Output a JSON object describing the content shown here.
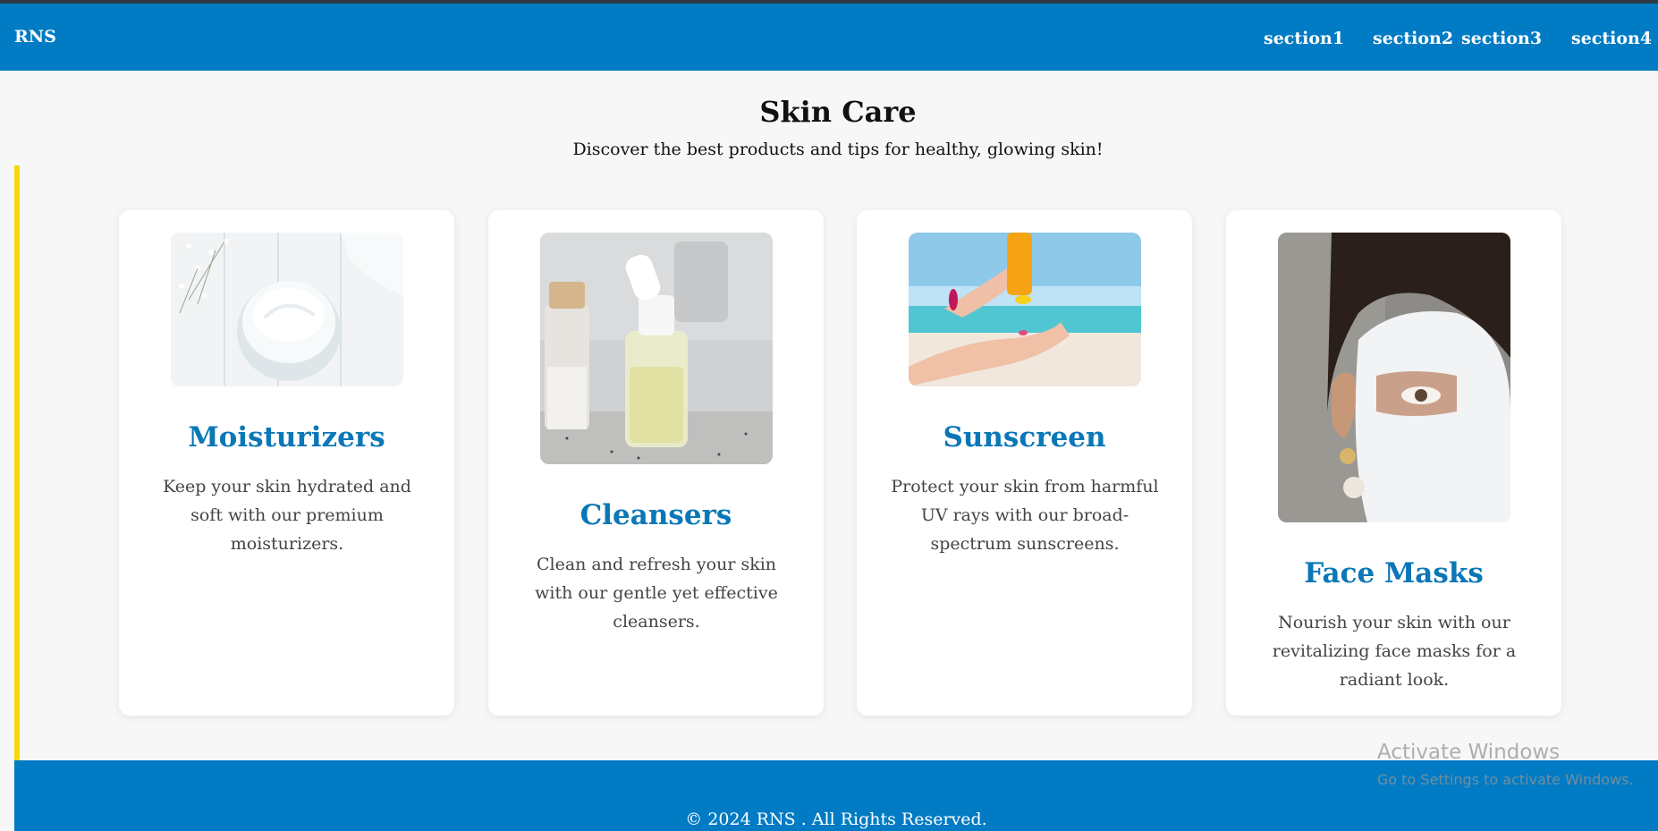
{
  "navbar": {
    "brand": "RNS",
    "links": [
      "section1",
      "section2",
      "section3",
      "section4"
    ]
  },
  "hero": {
    "title": "Skin Care",
    "subtitle": "Discover the best products and tips for healthy, glowing skin!"
  },
  "cards": [
    {
      "title": "Moisturizers",
      "description": "Keep your skin hydrated and soft with our premium moisturizers.",
      "image": "moisturizer-jar-image"
    },
    {
      "title": "Cleansers",
      "description": "Clean and refresh your skin with our gentle yet effective cleansers.",
      "image": "cleanser-bottle-image"
    },
    {
      "title": "Sunscreen",
      "description": "Protect your skin from harmful UV rays with our broad-spectrum sunscreens.",
      "image": "sunscreen-beach-image"
    },
    {
      "title": "Face Masks",
      "description": "Nourish your skin with our revitalizing face masks for a radiant look.",
      "image": "face-mask-image"
    }
  ],
  "footer": {
    "text": "© 2024 RNS . All Rights Reserved."
  },
  "watermark": {
    "title": "Activate Windows",
    "subtitle": "Go to Settings to activate Windows."
  },
  "colors": {
    "primary": "#017bc3",
    "accent": "#f5d90a",
    "card_title": "#0a77b7"
  }
}
